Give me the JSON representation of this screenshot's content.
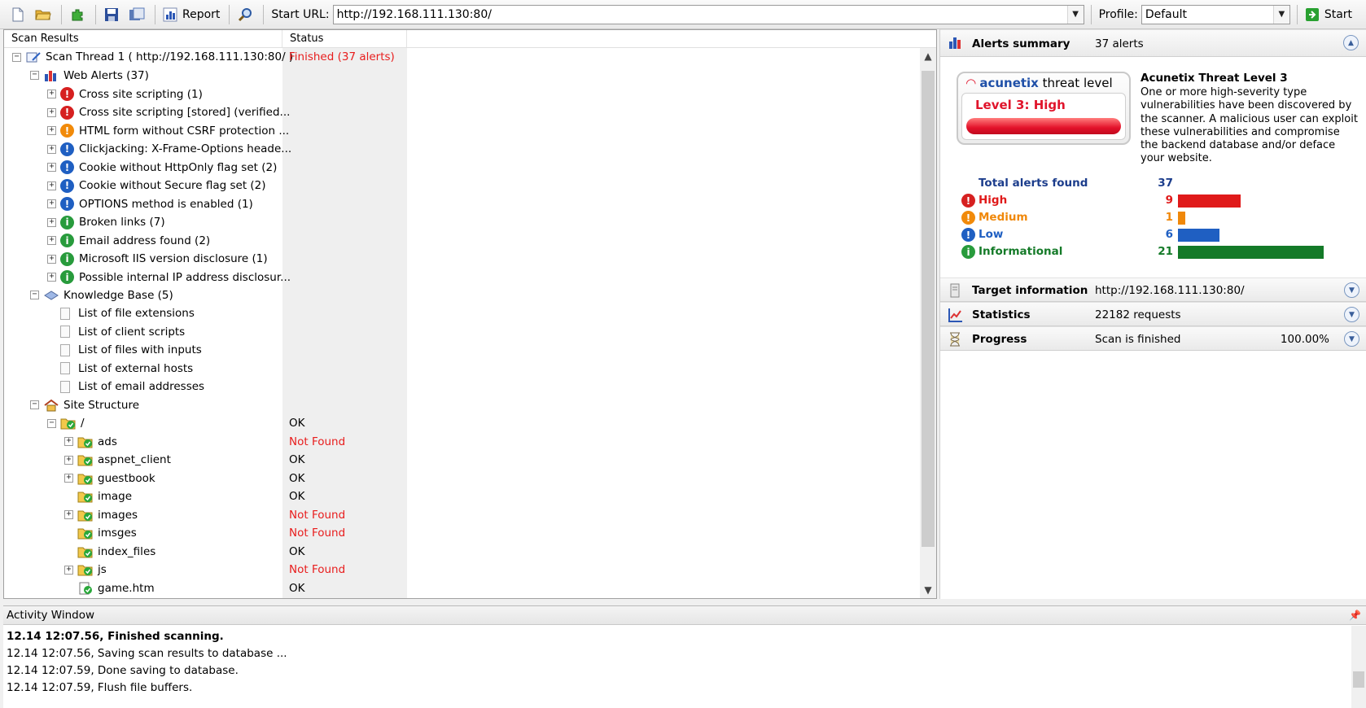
{
  "toolbar": {
    "report_label": "Report",
    "start_url_label": "Start URL:",
    "start_url_value": "http://192.168.111.130:80/",
    "profile_label": "Profile:",
    "profile_value": "Default",
    "start_label": "Start"
  },
  "tree": {
    "columns": [
      "Scan Results",
      "Status"
    ],
    "rows": [
      {
        "label": "Scan Thread 1 ( http://192.168.111.130:80/ )",
        "status": "Finished (37 alerts)",
        "level": 0,
        "type": "thread",
        "expander": "−",
        "status_red": true
      },
      {
        "label": "Web Alerts (37)",
        "status": "",
        "level": 1,
        "type": "webalerts",
        "expander": "−"
      },
      {
        "label": "Cross site scripting (1)",
        "status": "",
        "level": 2,
        "type": "high",
        "expander": "+"
      },
      {
        "label": "Cross site scripting [stored] (verified...",
        "status": "",
        "level": 2,
        "type": "high",
        "expander": "+"
      },
      {
        "label": "HTML form without CSRF protection ...",
        "status": "",
        "level": 2,
        "type": "medium",
        "expander": "+"
      },
      {
        "label": "Clickjacking: X-Frame-Options heade...",
        "status": "",
        "level": 2,
        "type": "low",
        "expander": "+"
      },
      {
        "label": "Cookie without HttpOnly flag set (2)",
        "status": "",
        "level": 2,
        "type": "low",
        "expander": "+"
      },
      {
        "label": "Cookie without Secure flag set (2)",
        "status": "",
        "level": 2,
        "type": "low",
        "expander": "+"
      },
      {
        "label": "OPTIONS method is enabled (1)",
        "status": "",
        "level": 2,
        "type": "low",
        "expander": "+"
      },
      {
        "label": "Broken links (7)",
        "status": "",
        "level": 2,
        "type": "info",
        "expander": "+"
      },
      {
        "label": "Email address found (2)",
        "status": "",
        "level": 2,
        "type": "info",
        "expander": "+"
      },
      {
        "label": "Microsoft IIS version disclosure (1)",
        "status": "",
        "level": 2,
        "type": "info",
        "expander": "+"
      },
      {
        "label": "Possible internal IP address disclosur...",
        "status": "",
        "level": 2,
        "type": "info",
        "expander": "+"
      },
      {
        "label": "Knowledge Base (5)",
        "status": "",
        "level": 1,
        "type": "kb",
        "expander": "−"
      },
      {
        "label": "List of file extensions",
        "status": "",
        "level": 2,
        "type": "doc",
        "expander": ""
      },
      {
        "label": "List of client scripts",
        "status": "",
        "level": 2,
        "type": "doc",
        "expander": ""
      },
      {
        "label": "List of files with inputs",
        "status": "",
        "level": 2,
        "type": "doc",
        "expander": ""
      },
      {
        "label": "List of external hosts",
        "status": "",
        "level": 2,
        "type": "doc",
        "expander": ""
      },
      {
        "label": "List of email addresses",
        "status": "",
        "level": 2,
        "type": "doc",
        "expander": ""
      },
      {
        "label": "Site Structure",
        "status": "",
        "level": 1,
        "type": "site",
        "expander": "−"
      },
      {
        "label": "/",
        "status": "OK",
        "level": 2,
        "type": "folder",
        "expander": "−"
      },
      {
        "label": "ads",
        "status": "Not Found",
        "level": 3,
        "type": "folder",
        "expander": "+",
        "status_red": true
      },
      {
        "label": "aspnet_client",
        "status": "OK",
        "level": 3,
        "type": "folder",
        "expander": "+"
      },
      {
        "label": "guestbook",
        "status": "OK",
        "level": 3,
        "type": "folder",
        "expander": "+"
      },
      {
        "label": "image",
        "status": "OK",
        "level": 3,
        "type": "folder",
        "expander": ""
      },
      {
        "label": "images",
        "status": "Not Found",
        "level": 3,
        "type": "folder",
        "expander": "+",
        "status_red": true
      },
      {
        "label": "imsges",
        "status": "Not Found",
        "level": 3,
        "type": "folder",
        "expander": "",
        "status_red": true
      },
      {
        "label": "index_files",
        "status": "OK",
        "level": 3,
        "type": "folder",
        "expander": ""
      },
      {
        "label": "js",
        "status": "Not Found",
        "level": 3,
        "type": "folder",
        "expander": "+",
        "status_red": true
      },
      {
        "label": "game.htm",
        "status": "OK",
        "level": 3,
        "type": "file",
        "expander": ""
      }
    ]
  },
  "alerts_summary": {
    "title": "Alerts summary",
    "value": "37 alerts",
    "threat_brand": "acunetix",
    "threat_word": " threat level",
    "threat_level_text": "Level 3: High",
    "desc_title": "Acunetix Threat Level 3",
    "desc_text": "One or more high-severity type vulnerabilities have been discovered by the scanner. A malicious user can exploit these vulnerabilities and compromise the backend database and/or deface your website.",
    "total_label": "Total alerts found",
    "total_value": "37",
    "severities": [
      {
        "label": "High",
        "count": 9,
        "color": "#e01a1a",
        "icon": "!",
        "dot": "dot-high"
      },
      {
        "label": "Medium",
        "count": 1,
        "color": "#f0880a",
        "icon": "!",
        "dot": "dot-med"
      },
      {
        "label": "Low",
        "count": 6,
        "color": "#1f5fc2",
        "icon": "!",
        "dot": "dot-low"
      },
      {
        "label": "Informational",
        "count": 21,
        "color": "#147a28",
        "icon": "i",
        "dot": "dot-info"
      }
    ]
  },
  "target_info": {
    "title": "Target information",
    "value": "http://192.168.111.130:80/"
  },
  "statistics": {
    "title": "Statistics",
    "value": "22182 requests"
  },
  "progress": {
    "title": "Progress",
    "value": "Scan is finished",
    "percent": "100.00%"
  },
  "activity": {
    "title": "Activity Window",
    "lines": [
      {
        "text": "12.14 12:07.56, Finished scanning.",
        "bold": true
      },
      {
        "text": "12.14 12:07.56, Saving scan results to database ...",
        "bold": false
      },
      {
        "text": "12.14 12:07.59, Done saving to database.",
        "bold": false
      },
      {
        "text": "12.14 12:07.59, Flush file buffers.",
        "bold": false
      }
    ]
  },
  "colors": {
    "accent_blue": "#2050a8",
    "alert_red": "#e81d1d"
  }
}
